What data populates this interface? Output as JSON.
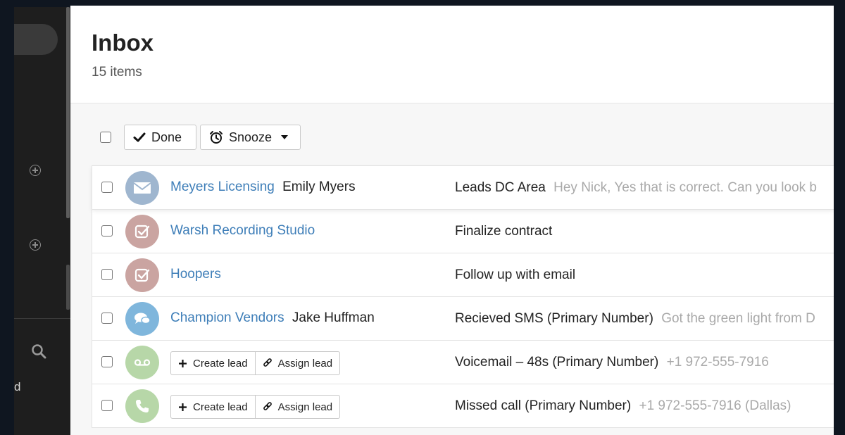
{
  "header": {
    "title": "Inbox",
    "count": "15 items"
  },
  "sidebar": {
    "partial_label": "d"
  },
  "toolbar": {
    "done_label": "Done",
    "snooze_label": "Snooze"
  },
  "colors": {
    "link": "#3e7eb8",
    "avatar_email": "#9fb6cf",
    "avatar_task": "#caa4a1",
    "avatar_sms": "#7fb6dc",
    "avatar_voicemail": "#b7d7a8"
  },
  "rows": [
    {
      "icon": "envelope-icon",
      "company": "Meyers Licensing",
      "person": "Emily Myers",
      "subject": "Leads DC Area",
      "preview": "Hey Nick, Yes that is correct. Can you look b"
    },
    {
      "icon": "task-check-icon",
      "company": "Warsh Recording Studio",
      "person": "",
      "subject": "Finalize contract",
      "preview": ""
    },
    {
      "icon": "task-check-icon",
      "company": "Hoopers",
      "person": "",
      "subject": "Follow up with email",
      "preview": ""
    },
    {
      "icon": "chat-bubbles-icon",
      "company": "Champion Vendors",
      "person": "Jake Huffman",
      "subject": "Recieved SMS (Primary Number)",
      "preview": "Got the green light from D"
    },
    {
      "icon": "voicemail-icon",
      "create_label": "Create lead",
      "assign_label": "Assign lead",
      "subject": "Voicemail – 48s (Primary Number)",
      "preview": "+1 972-555-7916"
    },
    {
      "icon": "phone-icon",
      "create_label": "Create lead",
      "assign_label": "Assign lead",
      "subject": "Missed call (Primary Number)",
      "preview": "+1 972-555-7916 (Dallas)"
    }
  ]
}
